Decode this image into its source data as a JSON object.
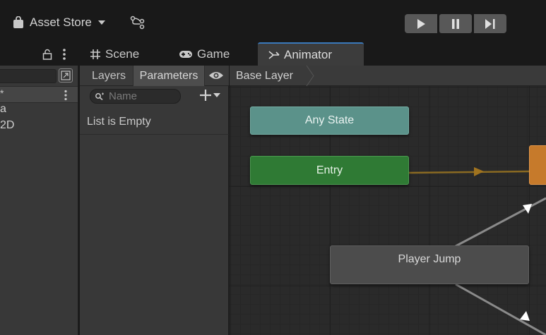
{
  "toolbar": {
    "asset_store_label": "Asset Store",
    "playback": [
      "play-icon",
      "pause-icon",
      "step-icon"
    ]
  },
  "tabs": {
    "scene": "Scene",
    "game": "Game",
    "animator": "Animator"
  },
  "hierarchy": {
    "header_marker": "*",
    "items": [
      "a",
      "2D"
    ]
  },
  "animator_panel": {
    "tabs": {
      "layers": "Layers",
      "parameters": "Parameters"
    },
    "search_placeholder": "Name",
    "empty_message": "List is Empty"
  },
  "graph": {
    "breadcrumb": "Base Layer",
    "nodes": {
      "any_state": "Any State",
      "entry": "Entry",
      "player_jump": "Player Jump"
    }
  },
  "colors": {
    "accent_tab": "#3a79bb",
    "any_state": "#5b928a",
    "entry": "#2f7a34",
    "default_state": "#c67a2b",
    "transition_default": "#a0731f"
  }
}
